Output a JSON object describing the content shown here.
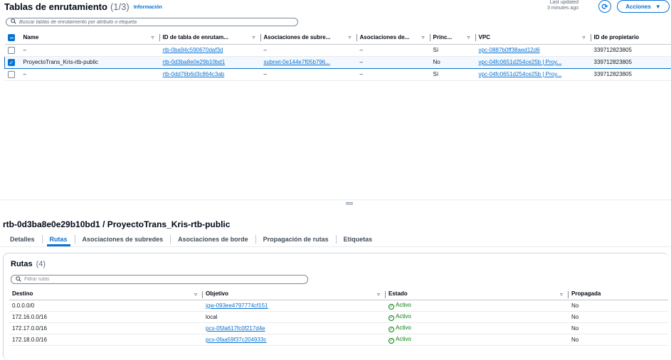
{
  "header": {
    "title": "Tablas de enrutamiento",
    "count": "(1/3)",
    "info_link": "Información",
    "last_updated_line1": "Last updated",
    "last_updated_line2": "3 minutes ago",
    "actions_label": "Acciones"
  },
  "search": {
    "placeholder": "Buscar tablas de enrutamiento por atributo o etiqueta"
  },
  "table": {
    "columns": [
      "Name",
      "ID de tabla de enrutam...",
      "Asociaciones de subre...",
      "Asociaciones de...",
      "Princ...",
      "VPC",
      "ID de propietario"
    ],
    "rows": [
      {
        "selected": false,
        "name": "–",
        "id": "rtb-0ba94c590670daf3d",
        "subnet_assoc": "–",
        "edge_assoc": "–",
        "main": "Sí",
        "vpc": "vpc-0887b0ff38aed12d6",
        "owner": "339712823805"
      },
      {
        "selected": true,
        "name": "ProyectoTrans_Kris-rtb-public",
        "id": "rtb-0d3ba8e0e29b10bd1",
        "subnet_assoc": "subnet-0e144e7f05b796...",
        "edge_assoc": "–",
        "main": "No",
        "vpc": "vpc-04fc0651d254ce25b | Proy...",
        "owner": "339712823805"
      },
      {
        "selected": false,
        "name": "–",
        "id": "rtb-0dd76b6d3c864c3ab",
        "subnet_assoc": "–",
        "edge_assoc": "–",
        "main": "Sí",
        "vpc": "vpc-04fc0651d254ce25b | Proy...",
        "owner": "339712823805"
      }
    ]
  },
  "detail": {
    "title": "rtb-0d3ba8e0e29b10bd1 / ProyectoTrans_Kris-rtb-public",
    "tabs": [
      "Detalles",
      "Rutas",
      "Asociaciones de subredes",
      "Asociaciones de borde",
      "Propagación de rutas",
      "Etiquetas"
    ],
    "active_tab": "Rutas"
  },
  "routes": {
    "title": "Rutas",
    "count": "(4)",
    "filter_placeholder": "Filtrar rutas",
    "columns": [
      "Destino",
      "Objetivo",
      "Estado",
      "Propagada"
    ],
    "rows": [
      {
        "destination": "0.0.0.0/0",
        "target": "igw-093ee4797774cf151",
        "target_link": true,
        "status": "Activo",
        "propagated": "No"
      },
      {
        "destination": "172.16.0.0/16",
        "target": "local",
        "target_link": false,
        "status": "Activo",
        "propagated": "No"
      },
      {
        "destination": "172.17.0.0/16",
        "target": "pcx-05fa617fc0f217d4e",
        "target_link": true,
        "status": "Activo",
        "propagated": "No"
      },
      {
        "destination": "172.18.0.0/16",
        "target": "pcx-0faa59f37c204933c",
        "target_link": true,
        "status": "Activo",
        "propagated": "No"
      }
    ]
  },
  "colors": {
    "accent": "#0972d3",
    "success": "#037f0c",
    "selected_row_bg": "#f2f8fd"
  }
}
